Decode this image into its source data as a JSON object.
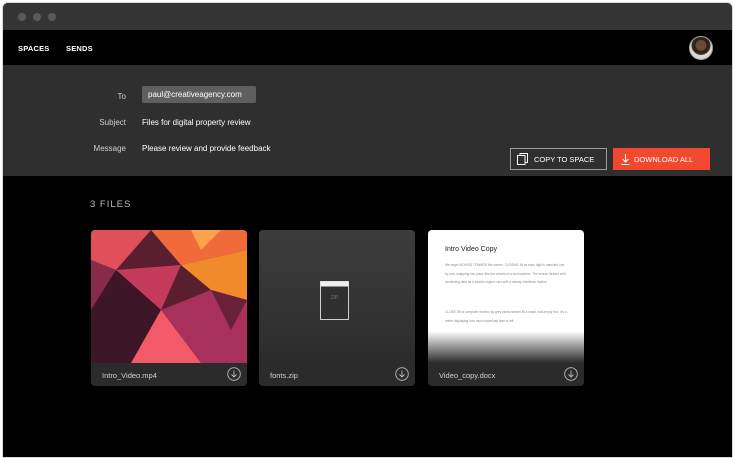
{
  "nav": {
    "spaces": "SPACES",
    "sends": "SENDS"
  },
  "send": {
    "to_label": "To",
    "to_value": "paul@creativeagency.com",
    "subject_label": "Subject",
    "subject_value": "Files for digital property review",
    "message_label": "Message",
    "message_value": "Please review and provide feedback"
  },
  "actions": {
    "copy_label": "COPY TO SPACE",
    "download_label": "DOWNLOAD ALL"
  },
  "files_heading": "3 FILES",
  "files": [
    {
      "name": "Intro_Video.mp4",
      "kind": "video"
    },
    {
      "name": "fonts.zip",
      "kind": "zip",
      "badge": "ZIP"
    },
    {
      "name": "Video_copy.docx",
      "kind": "document",
      "preview_title": "Intro Video Copy",
      "preview_p1": "We begin MOVING TOWARD the screen. CLOSING IN as each digit is matched one by one, snapping into place like the wheels of a slot machine. The screen flickers with windowing data as a search engine runs with a steady relentless rhythm.",
      "preview_p2": "CLOSE ON a computer monitor as grey pixels stream fill a small, half-empty box. It's a meter displaying how much download time is left."
    }
  ],
  "colors": {
    "accent": "#f0492f",
    "panel": "#2f2f2f",
    "background": "#000000"
  },
  "icons": {
    "copy": "copy-icon",
    "download": "download-icon",
    "file_download": "circle-download-icon"
  }
}
